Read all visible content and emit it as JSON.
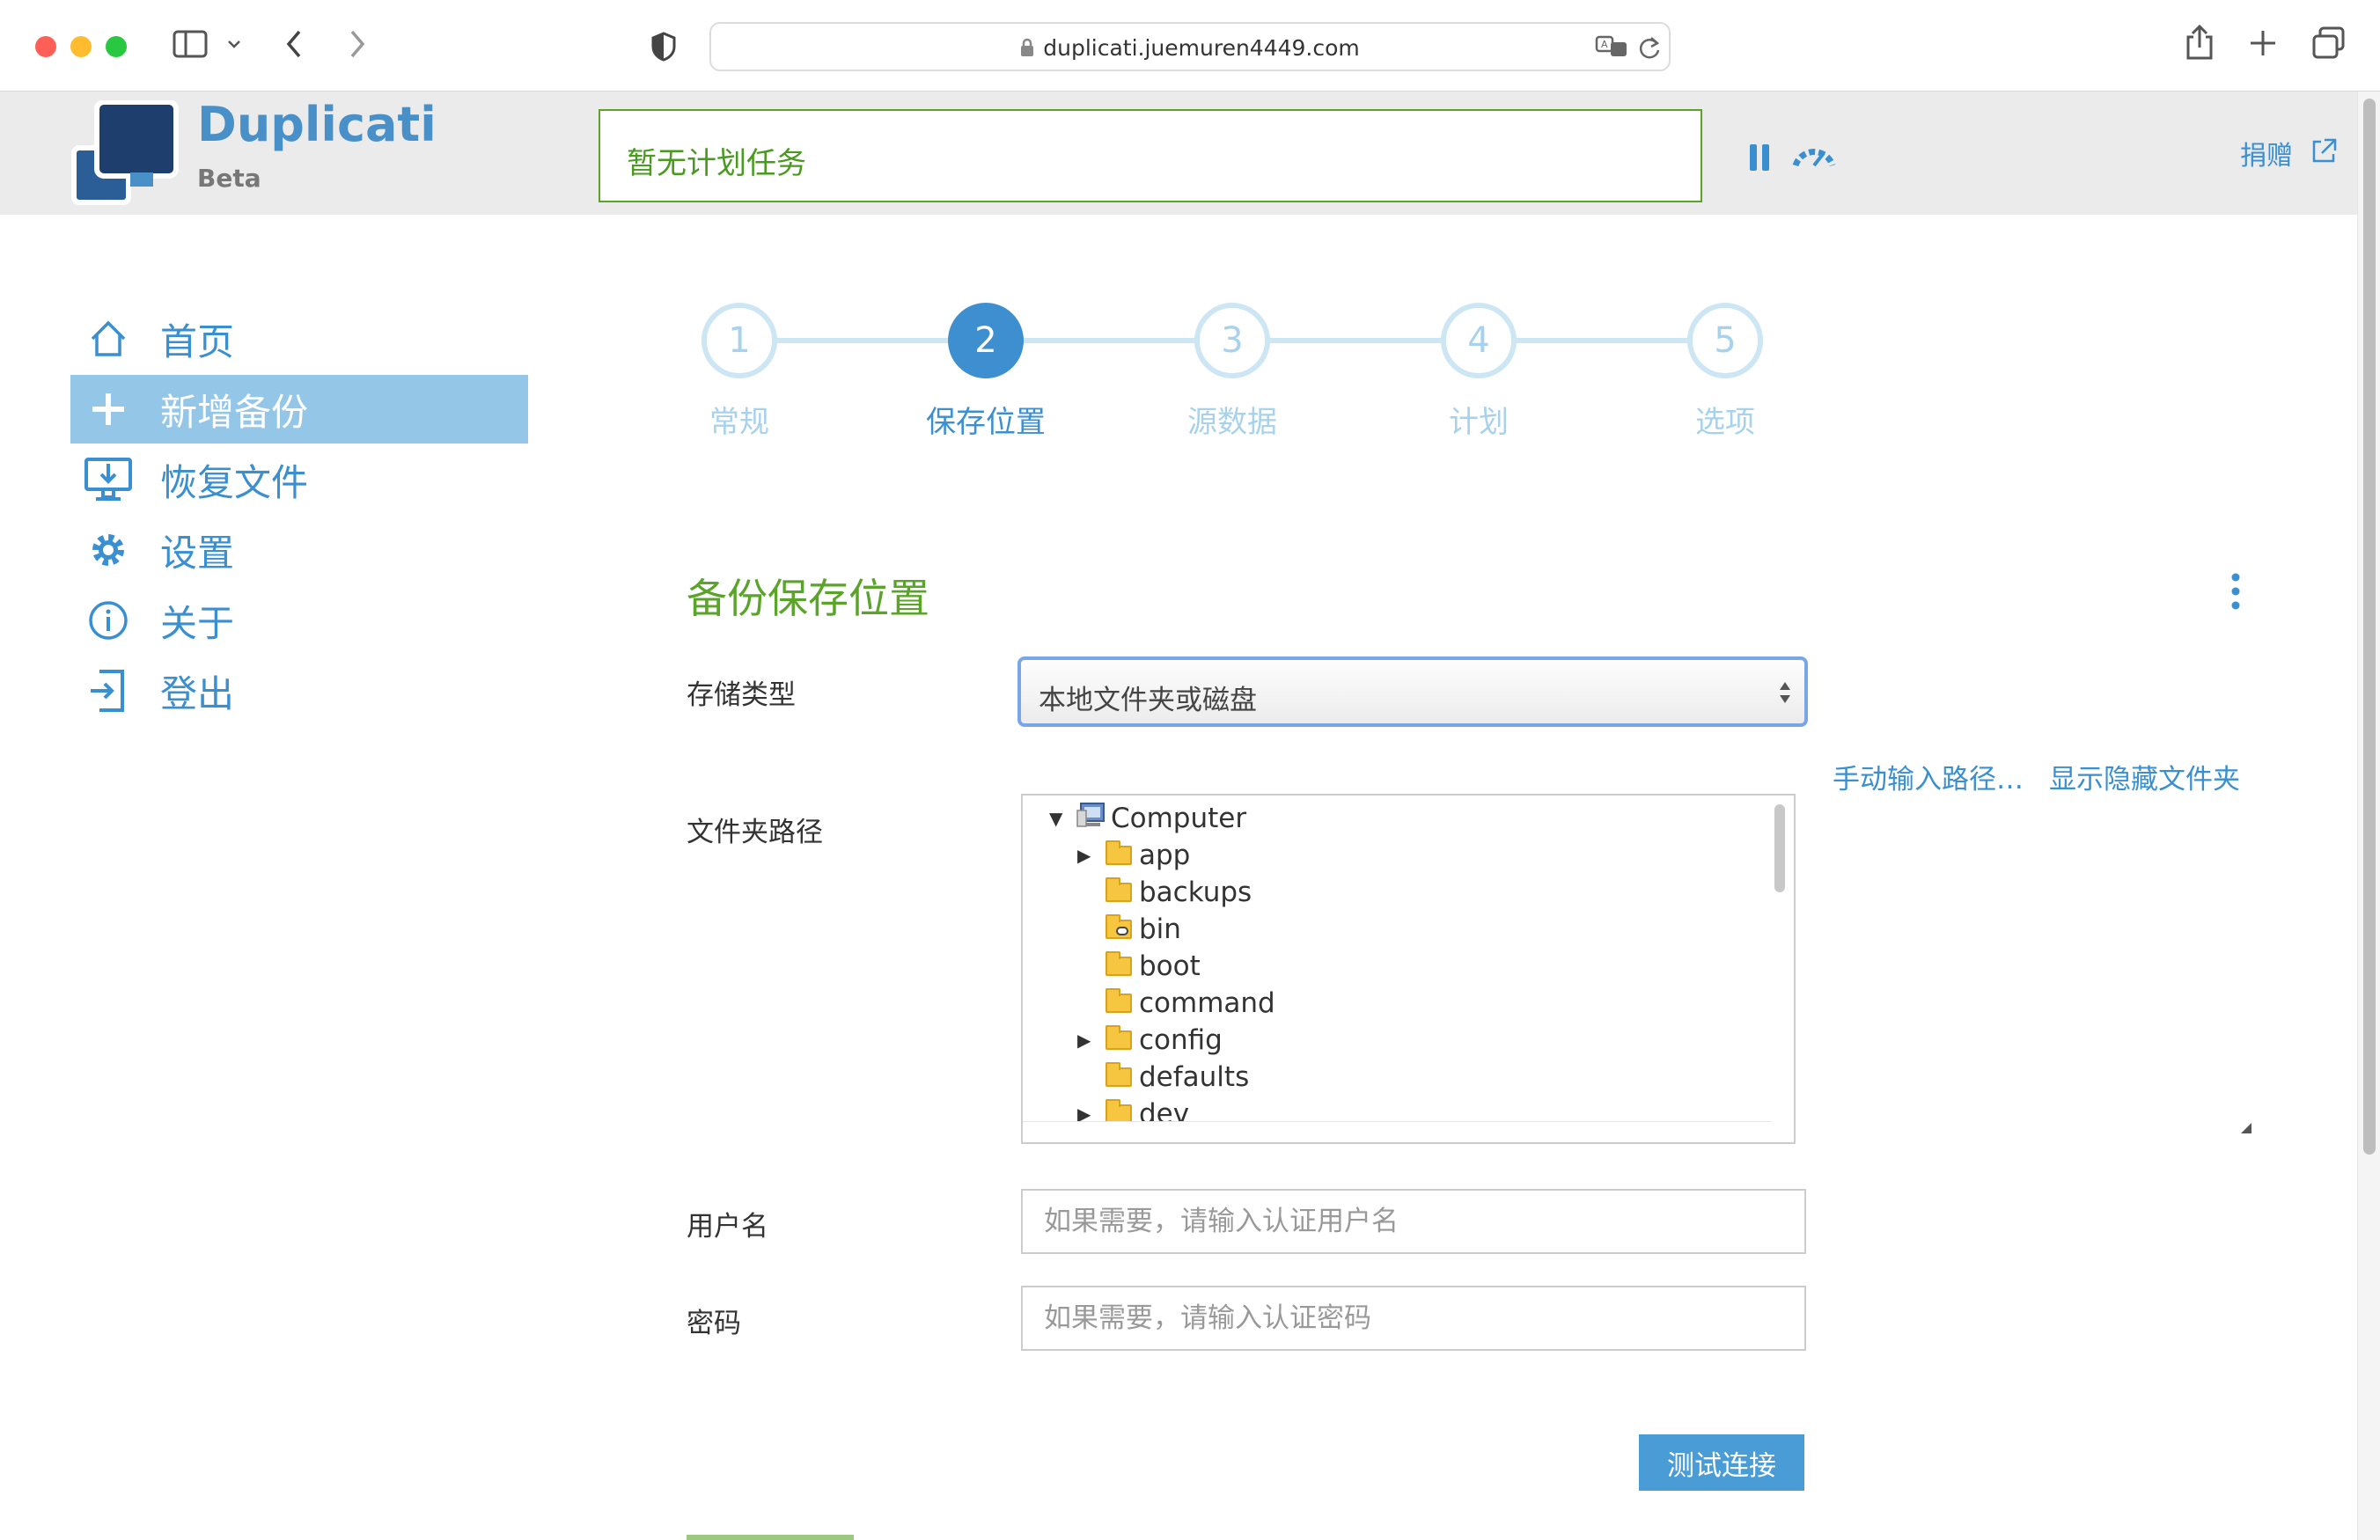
{
  "browser": {
    "url": "duplicati.juemuren4449.com"
  },
  "header": {
    "app_name": "Duplicati",
    "app_sub": "Beta",
    "status": "暂无计划任务",
    "donate": "捐赠"
  },
  "sidebar": {
    "items": [
      {
        "label": "首页",
        "icon": "home-icon"
      },
      {
        "label": "新增备份",
        "icon": "plus-icon",
        "active": true
      },
      {
        "label": "恢复文件",
        "icon": "restore-icon"
      },
      {
        "label": "设置",
        "icon": "gear-icon"
      },
      {
        "label": "关于",
        "icon": "info-icon"
      },
      {
        "label": "登出",
        "icon": "logout-icon"
      }
    ]
  },
  "steps": [
    {
      "number": "1",
      "label": "常规"
    },
    {
      "number": "2",
      "label": "保存位置",
      "active": true
    },
    {
      "number": "3",
      "label": "源数据"
    },
    {
      "number": "4",
      "label": "计划"
    },
    {
      "number": "5",
      "label": "选项"
    }
  ],
  "form": {
    "section_title": "备份保存位置",
    "storage_type_label": "存储类型",
    "storage_type_value": "本地文件夹或磁盘",
    "manual_path_link": "手动输入路径…",
    "show_hidden_link": "显示隐藏文件夹",
    "folder_path_label": "文件夹路径",
    "tree": [
      {
        "name": "Computer",
        "level": 0,
        "toggle": "expanded"
      },
      {
        "name": "app",
        "level": 1,
        "toggle": "collapsed"
      },
      {
        "name": "backups",
        "level": 1,
        "toggle": "none"
      },
      {
        "name": "bin",
        "level": 1,
        "toggle": "none",
        "link": true
      },
      {
        "name": "boot",
        "level": 1,
        "toggle": "none"
      },
      {
        "name": "command",
        "level": 1,
        "toggle": "none"
      },
      {
        "name": "config",
        "level": 1,
        "toggle": "collapsed"
      },
      {
        "name": "defaults",
        "level": 1,
        "toggle": "none"
      },
      {
        "name": "dev",
        "level": 1,
        "toggle": "collapsed"
      }
    ],
    "username_label": "用户名",
    "username_placeholder": "如果需要，请输入认证用户名",
    "password_label": "密码",
    "password_placeholder": "如果需要，请输入认证密码",
    "test_button": "测试连接"
  },
  "colors": {
    "accent": "#3d8fd0",
    "green": "#5aa42a",
    "active_nav": "#94c6e8"
  }
}
